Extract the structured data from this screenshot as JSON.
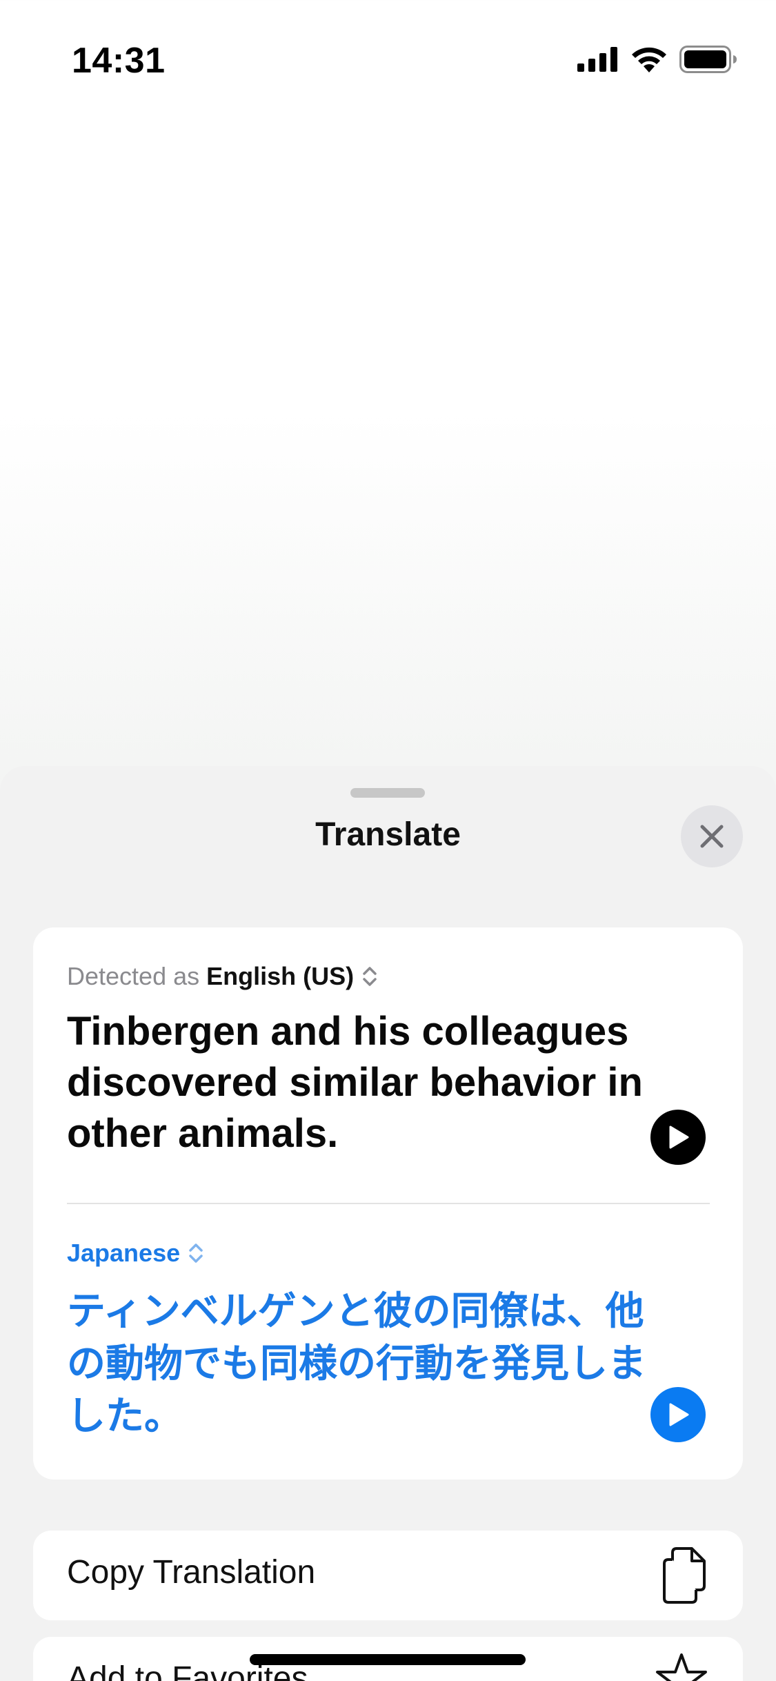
{
  "status_bar": {
    "time": "14:31",
    "icons": [
      "cellular-signal-icon",
      "wifi-icon",
      "battery-icon"
    ]
  },
  "sheet": {
    "title": "Translate",
    "close_icon": "close-icon"
  },
  "source": {
    "detected_prefix": "Detected as",
    "language": "English (US)",
    "text": "Tinbergen and his colleagues discovered similar behavior in other animals."
  },
  "target": {
    "language": "Japanese",
    "text": "ティンベルゲンと彼の同僚は、他の動物でも同様の行動を発見しました。"
  },
  "actions": [
    {
      "label": "Copy Translation",
      "icon": "copy-icon"
    },
    {
      "label": "Add to Favorites",
      "icon": "star-icon"
    }
  ],
  "colors": {
    "accent": "#1b7ae6",
    "play_target": "#0a7bf2",
    "play_source": "#000000"
  }
}
